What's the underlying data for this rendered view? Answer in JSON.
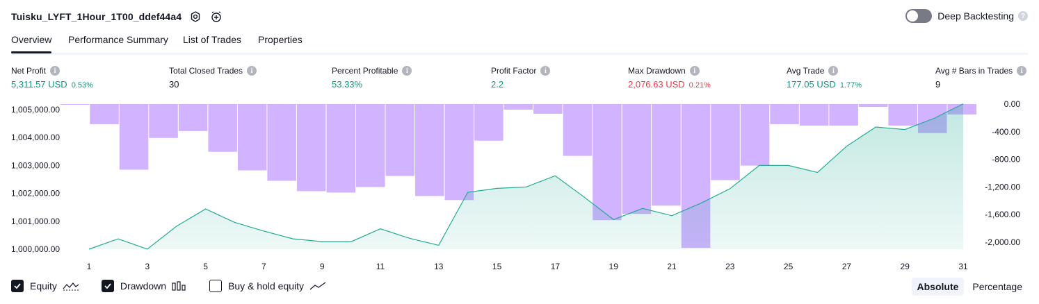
{
  "header": {
    "strategy_name": "Tuisku_LYFT_1Hour_1T00_ddef44a4",
    "deep_backtesting_label": "Deep Backtesting",
    "deep_backtesting_on": false
  },
  "tabs": [
    {
      "label": "Overview",
      "active": true
    },
    {
      "label": "Performance Summary",
      "active": false
    },
    {
      "label": "List of Trades",
      "active": false
    },
    {
      "label": "Properties",
      "active": false
    }
  ],
  "metrics": [
    {
      "label": "Net Profit",
      "value": "5,311.57 USD",
      "sub": "0.53%",
      "tone": "pos"
    },
    {
      "label": "Total Closed Trades",
      "value": "30",
      "sub": "",
      "tone": "neutral"
    },
    {
      "label": "Percent Profitable",
      "value": "53.33%",
      "sub": "",
      "tone": "pos"
    },
    {
      "label": "Profit Factor",
      "value": "2.2",
      "sub": "",
      "tone": "pos"
    },
    {
      "label": "Max Drawdown",
      "value": "2,076.63 USD",
      "sub": "0.21%",
      "tone": "neg"
    },
    {
      "label": "Avg Trade",
      "value": "177.05 USD",
      "sub": "1.77%",
      "tone": "pos"
    },
    {
      "label": "Avg # Bars in Trades",
      "value": "9",
      "sub": "",
      "tone": "neutral"
    }
  ],
  "chart_data": {
    "type": "line",
    "x": [
      1,
      2,
      3,
      4,
      5,
      6,
      7,
      8,
      9,
      10,
      11,
      12,
      13,
      14,
      15,
      16,
      17,
      18,
      19,
      20,
      21,
      22,
      23,
      24,
      25,
      26,
      27,
      28,
      29,
      30,
      31
    ],
    "x_ticks": [
      "1",
      "3",
      "5",
      "7",
      "9",
      "11",
      "13",
      "15",
      "17",
      "19",
      "21",
      "23",
      "25",
      "27",
      "29",
      "31"
    ],
    "y_left_ticks": [
      "1,000,000.00",
      "1,001,000.00",
      "1,002,000.00",
      "1,003,000.00",
      "1,004,000.00",
      "1,005,000.00"
    ],
    "y_left_lim": [
      1000000,
      1005200
    ],
    "y_right_ticks": [
      "0.00",
      "-400.00",
      "-800.00",
      "-1,200.00",
      "-1,600.00",
      "-2,000.00"
    ],
    "y_right_lim": [
      -2100,
      0
    ],
    "series": [
      {
        "name": "Equity",
        "axis": "left",
        "color": "#22ab94",
        "style": "line-area",
        "values": [
          1000000,
          1000370,
          1000000,
          1000820,
          1001440,
          1000960,
          1000650,
          1000370,
          1000270,
          1000270,
          1000730,
          1000390,
          1000140,
          1002040,
          1002180,
          1002230,
          1002630,
          1001860,
          1001060,
          1001460,
          1001200,
          1001650,
          1002170,
          1003000,
          1003000,
          1002750,
          1003690,
          1004380,
          1004290,
          1004690,
          1005210
        ]
      },
      {
        "name": "Drawdown",
        "axis": "right",
        "color": "#c9a6ff",
        "style": "bars",
        "values": [
          -10,
          -290,
          -950,
          -490,
          -390,
          -690,
          -960,
          -1110,
          -1260,
          -1280,
          -1200,
          -1040,
          -1330,
          -1390,
          -530,
          -80,
          -140,
          -750,
          -1680,
          -1590,
          -1470,
          -2080,
          -1100,
          -890,
          -290,
          -310,
          -310,
          -40,
          -310,
          -420,
          -150
        ]
      }
    ],
    "legend": [
      {
        "label": "Equity",
        "checked": true
      },
      {
        "label": "Drawdown",
        "checked": true
      },
      {
        "label": "Buy & hold equity",
        "checked": false
      }
    ],
    "modes": [
      {
        "label": "Absolute",
        "active": true
      },
      {
        "label": "Percentage",
        "active": false
      }
    ]
  }
}
